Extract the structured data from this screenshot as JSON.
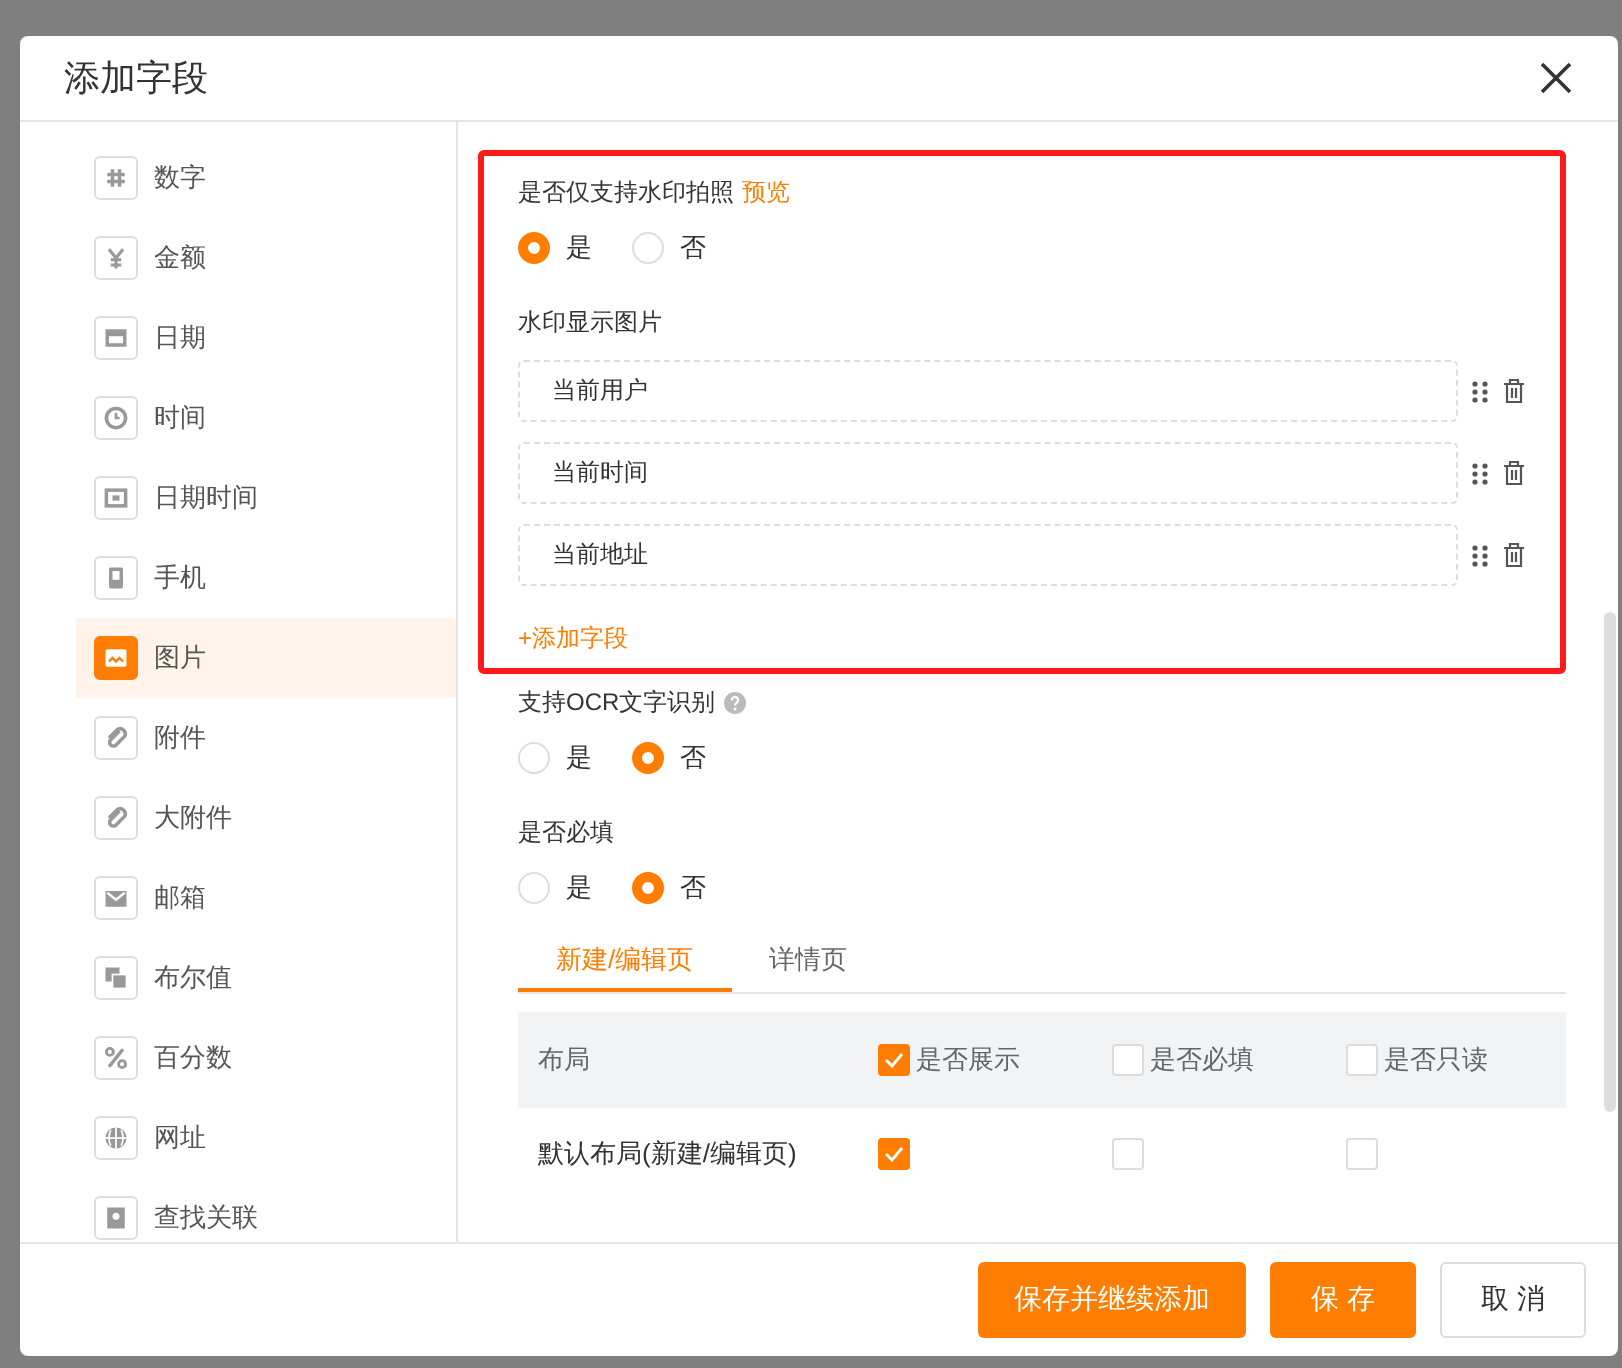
{
  "dialog": {
    "title": "添加字段"
  },
  "sidebar": {
    "items": [
      {
        "label": "数字",
        "selected": false
      },
      {
        "label": "金额",
        "selected": false
      },
      {
        "label": "日期",
        "selected": false
      },
      {
        "label": "时间",
        "selected": false
      },
      {
        "label": "日期时间",
        "selected": false
      },
      {
        "label": "手机",
        "selected": false
      },
      {
        "label": "图片",
        "selected": true
      },
      {
        "label": "附件",
        "selected": false
      },
      {
        "label": "大附件",
        "selected": false
      },
      {
        "label": "邮箱",
        "selected": false
      },
      {
        "label": "布尔值",
        "selected": false
      },
      {
        "label": "百分数",
        "selected": false
      },
      {
        "label": "网址",
        "selected": false
      },
      {
        "label": "查找关联",
        "selected": false
      }
    ]
  },
  "watermark_only": {
    "label": "是否仅支持水印拍照",
    "link": "预览",
    "options": [
      {
        "label": "是",
        "selected": true
      },
      {
        "label": "否",
        "selected": false
      }
    ]
  },
  "watermark_fields": {
    "label": "水印显示图片",
    "items": [
      "当前用户",
      "当前时间",
      "当前地址"
    ],
    "add_link": "+添加字段"
  },
  "ocr": {
    "label": "支持OCR文字识别",
    "options": [
      {
        "label": "是",
        "selected": false
      },
      {
        "label": "否",
        "selected": true
      }
    ]
  },
  "required": {
    "label": "是否必填",
    "options": [
      {
        "label": "是",
        "selected": false
      },
      {
        "label": "否",
        "selected": true
      }
    ]
  },
  "tabs": [
    {
      "label": "新建/编辑页",
      "selected": true
    },
    {
      "label": "详情页",
      "selected": false
    }
  ],
  "table": {
    "columns": [
      {
        "label": "布局"
      },
      {
        "label": "是否展示",
        "checked": true
      },
      {
        "label": "是否必填",
        "checked": false
      },
      {
        "label": "是否只读",
        "checked": false
      }
    ],
    "rows": [
      {
        "label": "默认布局(新建/编辑页)",
        "cells": [
          {
            "checked": true
          },
          {
            "checked": false
          },
          {
            "checked": false
          }
        ]
      }
    ]
  },
  "buttons": [
    {
      "label": "保存并继续添加",
      "kind": "primary"
    },
    {
      "label": "保 存",
      "kind": "primary"
    },
    {
      "label": "取 消",
      "kind": "default"
    }
  ]
}
